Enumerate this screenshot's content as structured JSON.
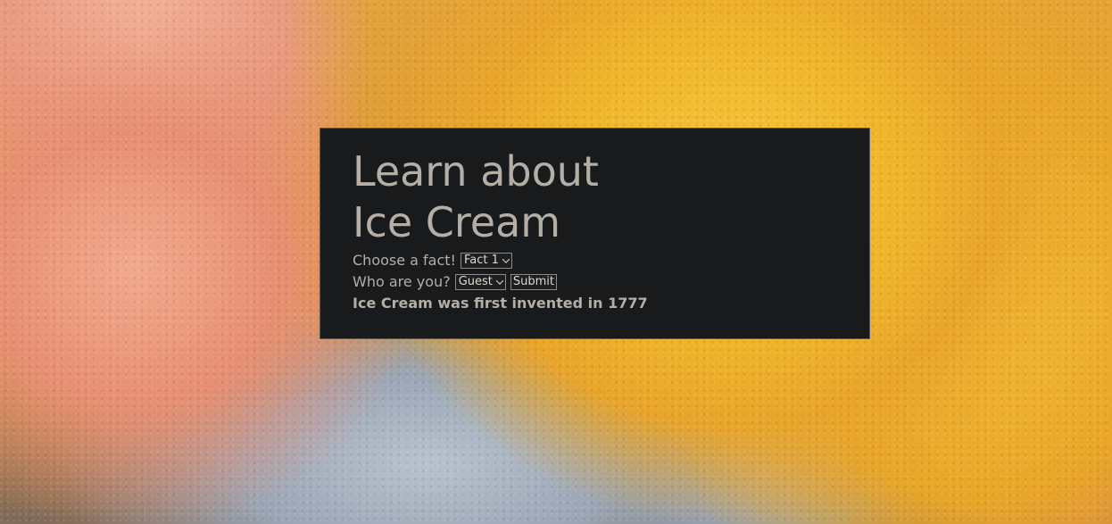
{
  "panel": {
    "title_line1": "Learn about",
    "title_line2": "Ice Cream",
    "fact_prompt": "Choose a fact!",
    "fact_select_value": "Fact 1",
    "user_prompt": "Who are you?",
    "user_select_value": "Guest",
    "submit_label": "Submit",
    "fact_text": "Ice Cream was first invented in 1777"
  },
  "colors": {
    "panel_background": "#181a1c",
    "panel_text": "#b4aea6"
  },
  "icons": {
    "select_chevron": "chevron-down-icon"
  }
}
